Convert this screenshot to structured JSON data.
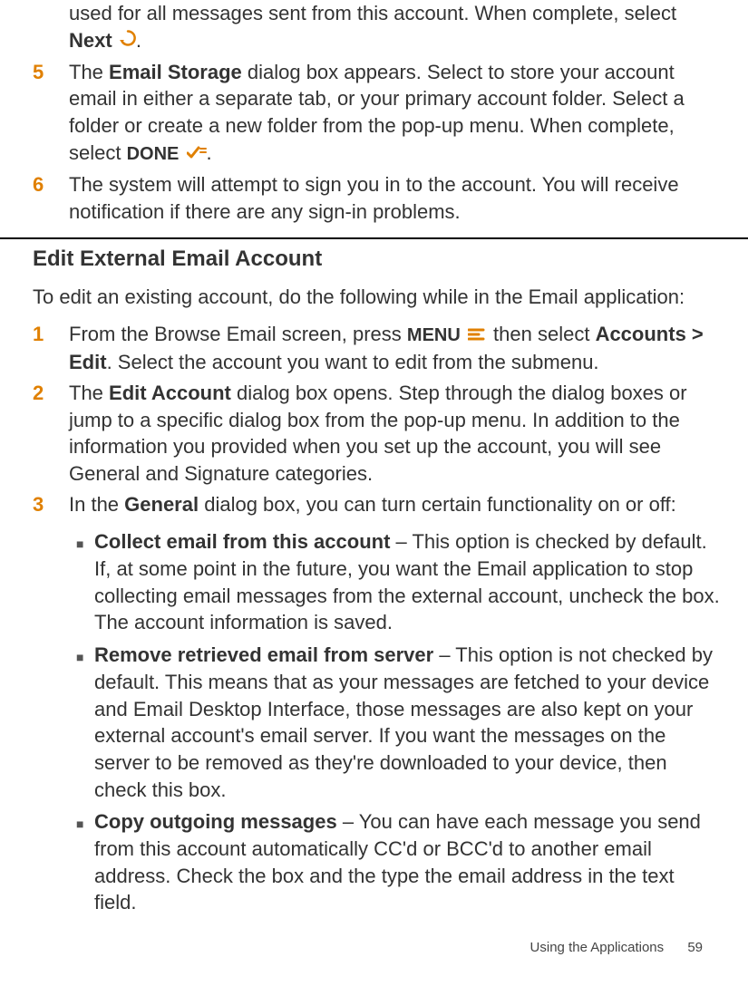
{
  "top": {
    "frag1": "used  for all messages sent from this account. When complete, select ",
    "next": "Next",
    "period": "."
  },
  "steps": {
    "s5": {
      "num": "5",
      "t1": "The ",
      "t2": "Email Storage",
      "t3": " dialog box appears. Select to store your account email in either a separate tab, or your primary account folder. Select a folder or create a new folder from the pop-up menu. When complete, select ",
      "done": "DONE",
      "period": "."
    },
    "s6": {
      "num": "6",
      "t": "The system will attempt to sign you in to the account. You will receive notification if there are any sign-in problems."
    }
  },
  "section2": {
    "heading": "Edit External Email Account",
    "intro": "To edit an existing account, do the following while in the Email application:",
    "s1": {
      "num": "1",
      "t1": "From the Browse Email screen, press ",
      "menu": "MENU",
      "t2": " then select ",
      "accedit": "Accounts > Edit",
      "t3": ". Select the account you want to edit from the submenu."
    },
    "s2": {
      "num": "2",
      "t1": "The ",
      "editacct": "Edit Account",
      "t2": " dialog box opens. Step through the dialog boxes or jump to a specific dialog box from the pop-up menu. In addition to the information you provided when you set up the account, you will see General and Signature categories."
    },
    "s3": {
      "num": "3",
      "t1": "In the ",
      "general": "General",
      "t2": " dialog box, you can turn certain functionality on or off:"
    },
    "bullets": {
      "b1": {
        "title": "Collect email from this account",
        "text": " – This option is checked by default. If, at some point in the future, you want the Email application to stop collecting email messages from the external account, uncheck the box. The account information is saved."
      },
      "b2": {
        "title": "Remove retrieved email from server",
        "text": " – This option is not checked by default. This means that as your messages are fetched to your device and Email Desktop Interface, those messages are also kept on your external account's email server. If you want the messages on the server to be removed as they're downloaded to your device, then check this box."
      },
      "b3": {
        "title": "Copy outgoing messages",
        "text": " – You can have each message you send from this account automatically CC'd or BCC'd to another email address. Check the box and the type the email address in the text field."
      }
    }
  },
  "footer": {
    "label": "Using the Applications",
    "page": "59"
  }
}
